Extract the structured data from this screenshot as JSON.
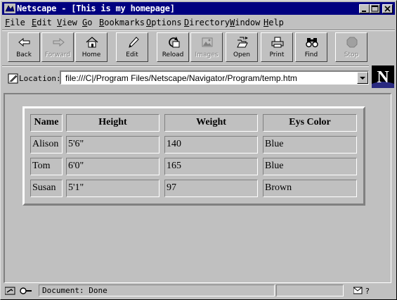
{
  "window": {
    "title": "Netscape - [This is my homepage]"
  },
  "menu": [
    "File",
    "Edit",
    "View",
    "Go",
    "Bookmarks",
    "Options",
    "Directory",
    "Window",
    "Help"
  ],
  "toolbar": {
    "back": "Back",
    "forward": "Forward",
    "home": "Home",
    "edit": "Edit",
    "reload": "Reload",
    "images": "Images",
    "open": "Open",
    "print": "Print",
    "find": "Find",
    "stop": "Stop"
  },
  "location": {
    "label": "Location:",
    "url": "file:///C|/Program Files/Netscape/Navigator/Program/temp.htm"
  },
  "table": {
    "headers": [
      "Name",
      "Height",
      "Weight",
      "Eys Color"
    ],
    "rows": [
      [
        "Alison",
        "5'6\"",
        "140",
        "Blue"
      ],
      [
        "Tom",
        "6'0\"",
        "165",
        "Blue"
      ],
      [
        "Susan",
        "5'1\"",
        "97",
        "Brown"
      ]
    ]
  },
  "status": {
    "text": "Document: Done"
  },
  "icons": {
    "app": "netscape-icon",
    "location": "location-bookmark-icon",
    "brand": "netscape-n-logo",
    "security": "security-key-icon",
    "mail": "mail-icon"
  }
}
